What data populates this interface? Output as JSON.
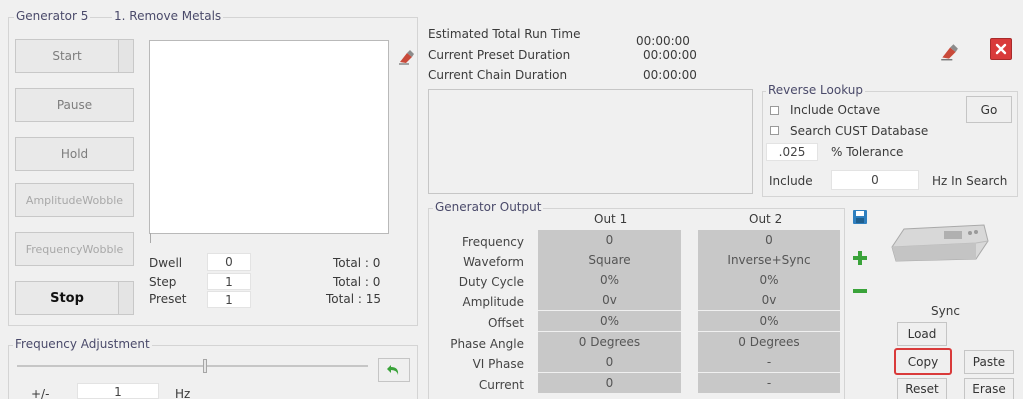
{
  "left_panel": {
    "generator_title": "Generator 5",
    "program_title": "1. Remove Metals",
    "buttons": {
      "start": "Start",
      "pause": "Pause",
      "hold": "Hold",
      "amplitude_wobble_1": "Amplitude",
      "amplitude_wobble_2": "Wobble",
      "frequency_wobble_1": "Frequency",
      "frequency_wobble_2": "Wobble",
      "stop": "Stop"
    },
    "counters": {
      "dwell_label": "Dwell",
      "dwell_value": "0",
      "dwell_total": "Total : 0",
      "step_label": "Step",
      "step_value": "1",
      "step_total": "Total : 0",
      "preset_label": "Preset",
      "preset_value": "1",
      "preset_total": "Total : 15"
    },
    "frequency_adjustment": {
      "title": "Frequency Adjustment",
      "plus_minus_label": "+/-",
      "value": "1",
      "unit": "Hz"
    }
  },
  "run_info": {
    "estimated_total_label": "Estimated Total Run Time",
    "estimated_total_value": "00:00:00",
    "preset_duration_label": "Current Preset Duration",
    "preset_duration_value": "00:00:00",
    "chain_duration_label": "Current Chain Duration",
    "chain_duration_value": "00:00:00"
  },
  "reverse_lookup": {
    "title": "Reverse Lookup",
    "include_octave": "Include Octave",
    "search_cust": "Search CUST Database",
    "tolerance_value": ".025",
    "tolerance_label": "% Tolerance",
    "include_label": "Include",
    "include_value": "0",
    "hz_in_search": "Hz In Search",
    "go_button": "Go"
  },
  "generator_output": {
    "title": "Generator Output",
    "columns": [
      "Out 1",
      "Out 2"
    ],
    "rows": [
      {
        "label": "Frequency",
        "out1": "0",
        "out2": "0"
      },
      {
        "label": "Waveform",
        "out1": "Square",
        "out2": "Inverse+Sync"
      },
      {
        "label": "Duty Cycle",
        "out1": "0%",
        "out2": "0%"
      },
      {
        "label": "Amplitude",
        "out1": "0v",
        "out2": "0v"
      },
      {
        "label": "Offset",
        "out1": "0%",
        "out2": "0%"
      },
      {
        "label": "Phase Angle",
        "out1": "0 Degrees",
        "out2": "0 Degrees"
      },
      {
        "label": "VI Phase",
        "out1": "0",
        "out2": "-"
      },
      {
        "label": "Current",
        "out1": "0",
        "out2": "-"
      }
    ]
  },
  "sync_panel": {
    "sync_label": "Sync",
    "load": "Load",
    "copy": "Copy",
    "paste": "Paste",
    "reset": "Reset",
    "erase": "Erase"
  },
  "colors": {
    "accent_red": "#d93a3a",
    "green_icon": "#3aa33a",
    "table_cell": "#c8c8c8"
  }
}
